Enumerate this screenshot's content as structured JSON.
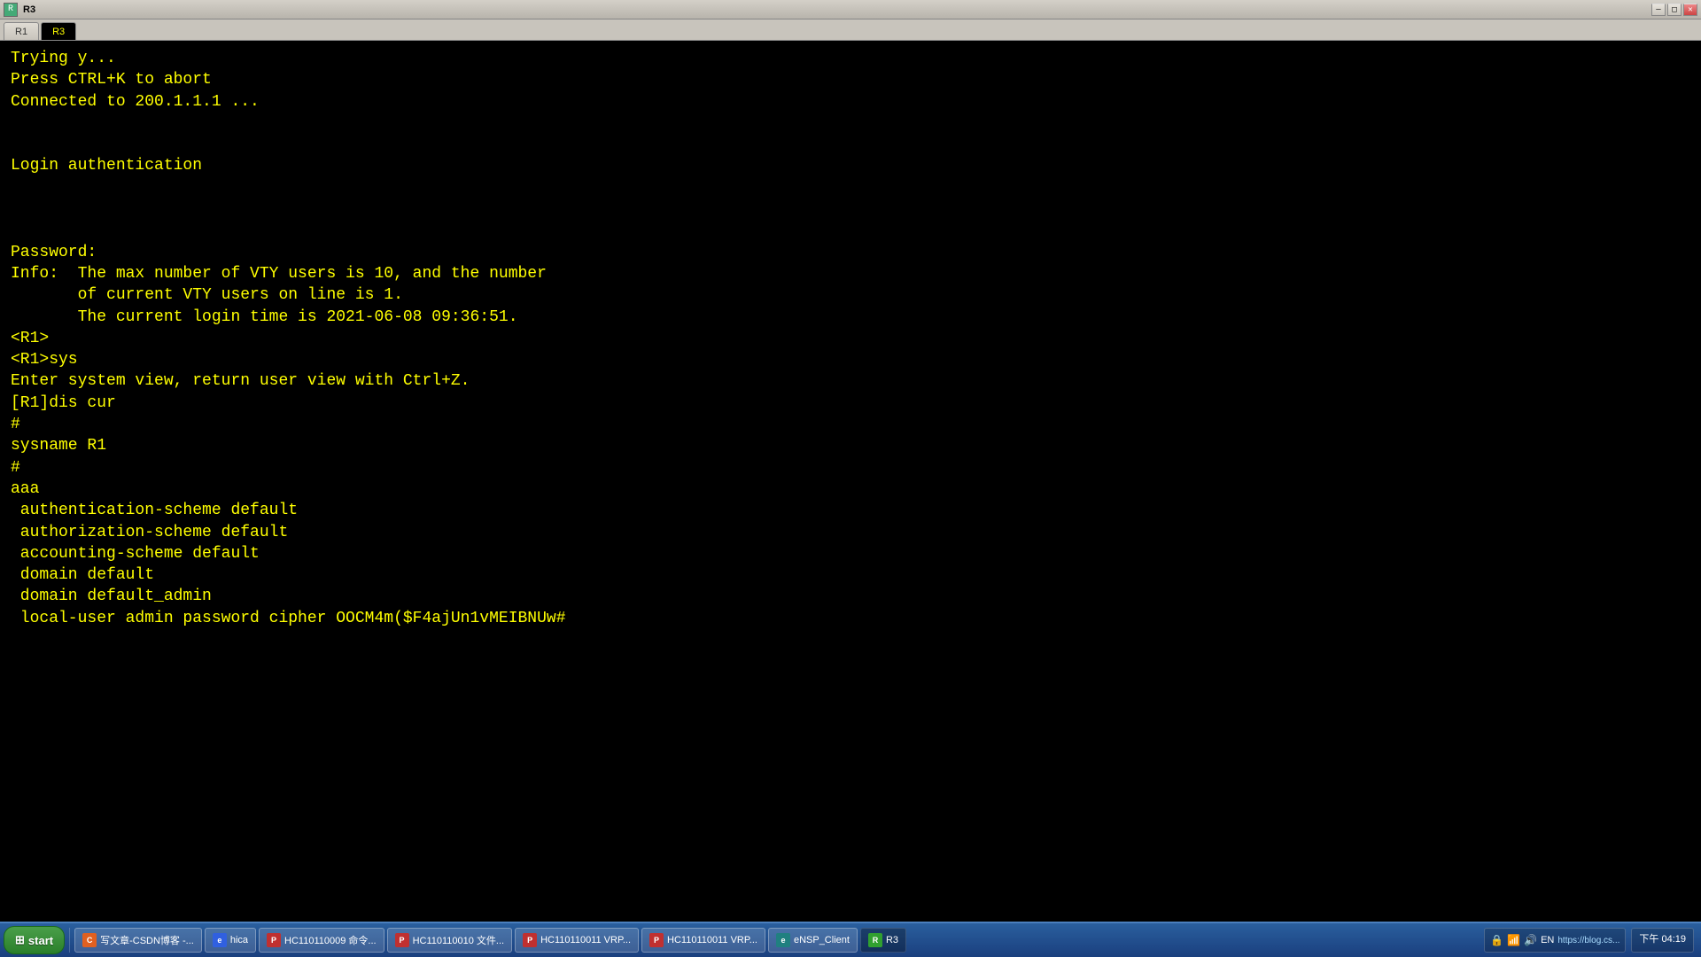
{
  "window": {
    "title": "R3",
    "tabs": [
      {
        "id": "R1",
        "label": "R1",
        "active": false
      },
      {
        "id": "R3",
        "label": "R3",
        "active": true
      }
    ],
    "controls": [
      "—",
      "□",
      "✕"
    ]
  },
  "terminal": {
    "lines": [
      "Trying y...",
      "Press CTRL+K to abort",
      "Connected to 200.1.1.1 ...",
      "",
      "",
      "Login authentication",
      "",
      "",
      "",
      "Password:",
      "Info:  The max number of VTY users is 10, and the number",
      "       of current VTY users on line is 1.",
      "       The current login time is 2021-06-08 09:36:51.",
      "<R1>",
      "<R1>sys",
      "Enter system view, return user view with Ctrl+Z.",
      "[R1]dis cur",
      "#",
      "sysname R1",
      "#",
      "aaa",
      " authentication-scheme default",
      " authorization-scheme default",
      " accounting-scheme default",
      " domain default",
      " domain default_admin",
      " local-user admin password cipher OOCM4m($F4ajUn1vMEIBNUw#"
    ]
  },
  "taskbar": {
    "start_label": "start",
    "items": [
      {
        "id": "csdn",
        "label": "写文章-CSDN博客 -...",
        "color": "orange",
        "text": "C"
      },
      {
        "id": "ie",
        "label": "hica",
        "color": "blue",
        "text": "e"
      },
      {
        "id": "hc1",
        "label": "HC110110009 命令...",
        "color": "red",
        "text": "P"
      },
      {
        "id": "hc2",
        "label": "HC110110010 文件...",
        "color": "red",
        "text": "P"
      },
      {
        "id": "hc3",
        "label": "HC110110011 VRP...",
        "color": "red",
        "text": "P"
      },
      {
        "id": "hc4",
        "label": "HC110110011 VRP...",
        "color": "red",
        "text": "P"
      },
      {
        "id": "ensp",
        "label": "eNSP_Client",
        "color": "teal",
        "text": "e"
      },
      {
        "id": "r3",
        "label": "R3",
        "color": "green",
        "text": "R",
        "active": true
      }
    ],
    "systray": {
      "items": [
        "🔒",
        "📶",
        "🔊",
        "EN"
      ]
    },
    "clock": {
      "time": "https://blog.cs...",
      "display": "下午 04:19"
    }
  }
}
